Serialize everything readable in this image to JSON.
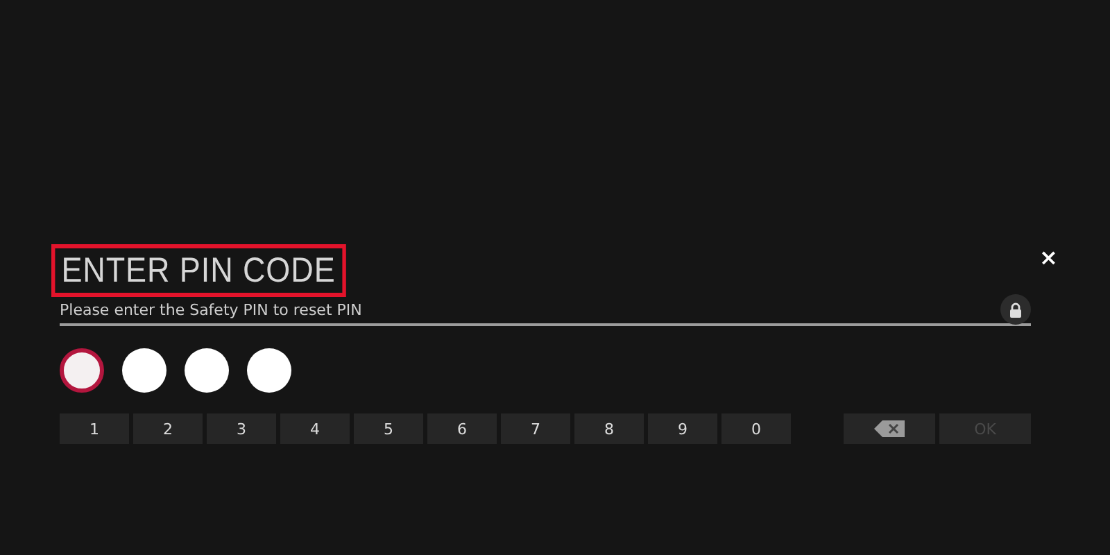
{
  "dialog": {
    "title": "ENTER PIN CODE",
    "title_highlighted": true,
    "subtitle": "Please enter the Safety PIN to reset PIN",
    "close": "×"
  },
  "pin_dots": [
    {
      "focused": true
    },
    {
      "focused": false
    },
    {
      "focused": false
    },
    {
      "focused": false
    }
  ],
  "keys": [
    "1",
    "2",
    "3",
    "4",
    "5",
    "6",
    "7",
    "8",
    "9",
    "0"
  ],
  "actions": [
    {
      "kind": "backspace",
      "disabled": false
    },
    {
      "kind": "ok",
      "label": "OK",
      "disabled": true
    }
  ]
}
